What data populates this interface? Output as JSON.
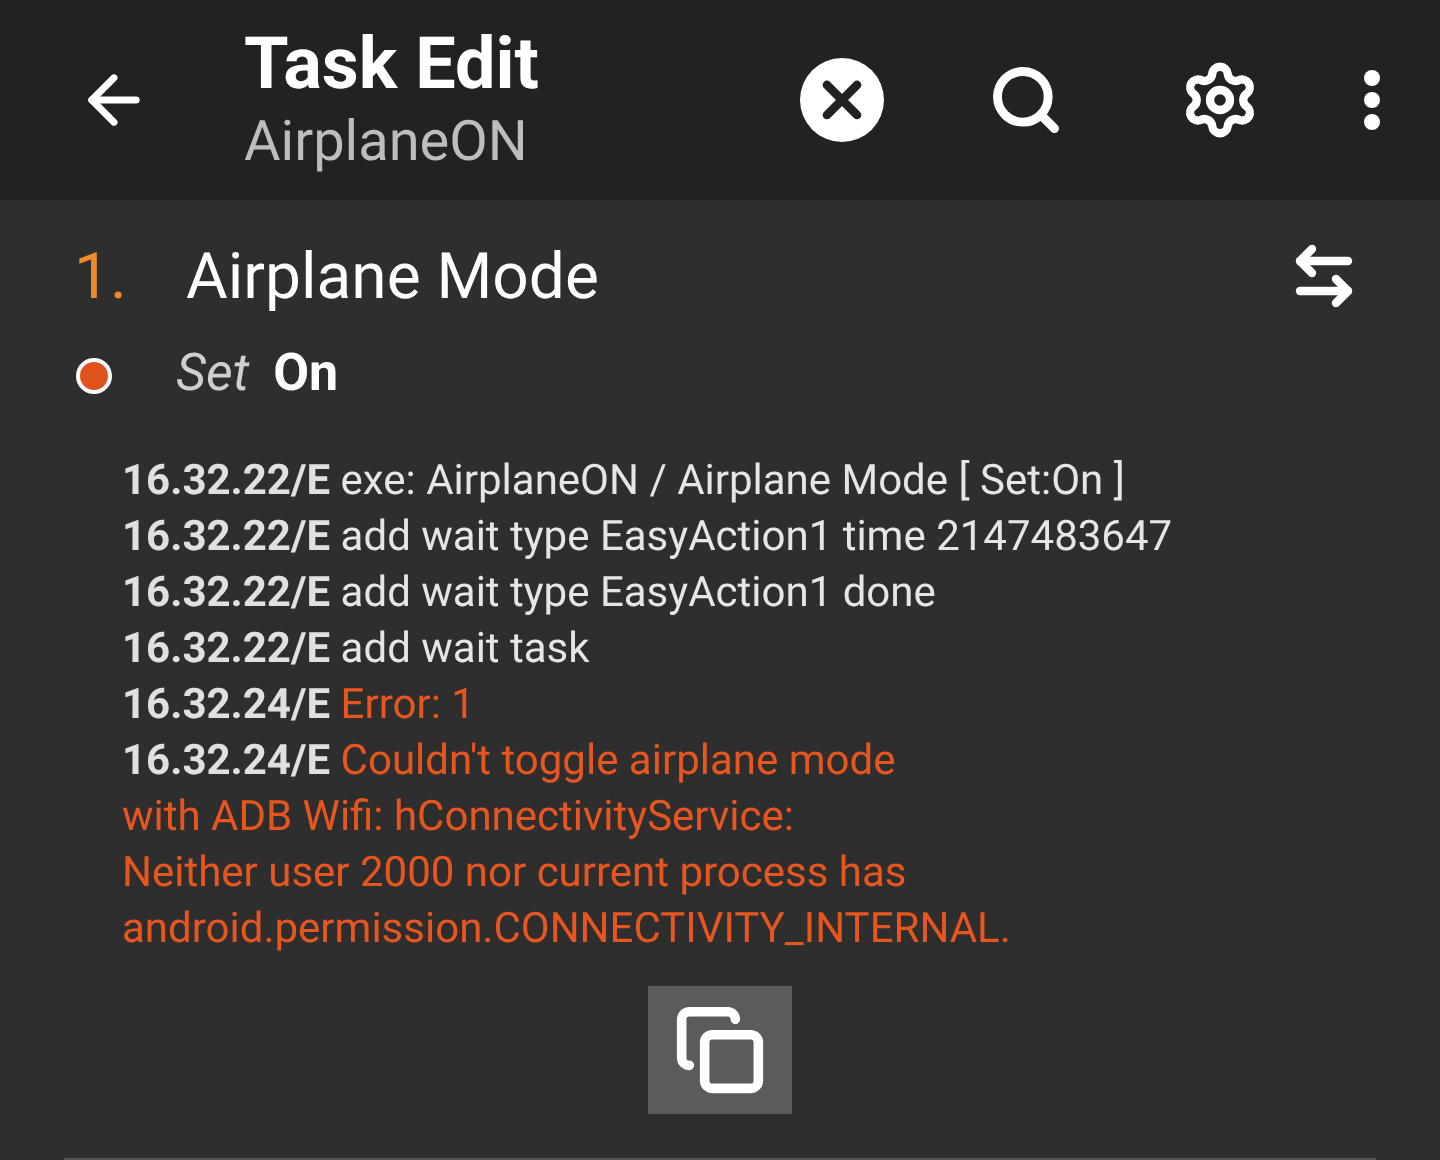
{
  "app_bar": {
    "title": "Task Edit",
    "subtitle": "AirplaneON"
  },
  "action": {
    "number": "1.",
    "name": "Airplane Mode",
    "parameter_label": "Set",
    "parameter_value": "On"
  },
  "log": [
    {
      "kind": "info",
      "time": "16.32.22/E",
      "message": "exe: AirplaneON / Airplane Mode [ Set:On ]"
    },
    {
      "kind": "info",
      "time": "16.32.22/E",
      "message": "add wait type EasyAction1 time 2147483647"
    },
    {
      "kind": "info",
      "time": "16.32.22/E",
      "message": "add wait type EasyAction1 done"
    },
    {
      "kind": "info",
      "time": "16.32.22/E",
      "message": "add wait task"
    },
    {
      "kind": "error",
      "time": "16.32.24/E",
      "message": "Error: 1"
    },
    {
      "kind": "error",
      "time": "16.32.24/E",
      "message": "Couldn't toggle airplane mode\nwith ADB Wifi: hConnectivityService:\nNeither user 2000 nor current process has\nandroid.permission.CONNECTIVITY_INTERNAL."
    }
  ]
}
